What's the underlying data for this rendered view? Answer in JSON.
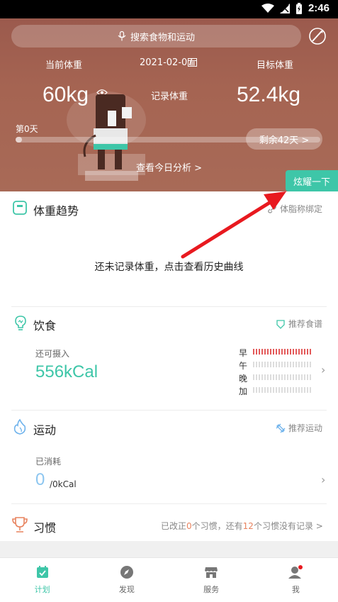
{
  "status_bar": {
    "time": "2:46"
  },
  "header": {
    "search_placeholder": "搜索食物和运动",
    "current_weight_label": "当前体重",
    "date": "2021-02-07",
    "target_weight_label": "目标体重",
    "current_weight": "60kg",
    "record_weight_label": "记录体重",
    "target_weight": "52.4kg",
    "day_label": "第0天",
    "remaining_label": "剩余42天 >",
    "progress": 0.02,
    "analysis_link": "查看今日分析 >"
  },
  "brag_button": "炫耀一下",
  "weight_trend": {
    "title": "体重趋势",
    "action": "体脂称绑定",
    "empty_text": "还未记录体重，点击查看历史曲线"
  },
  "diet": {
    "title": "饮食",
    "action": "推荐食谱",
    "remaining_label": "还可摄入",
    "kcal": "556kCal",
    "meals": [
      "早",
      "午",
      "晚",
      "加"
    ]
  },
  "exercise": {
    "title": "运动",
    "action": "推荐运动",
    "burned_label": "已消耗",
    "burned_value": "0",
    "burned_unit": "/0kCal"
  },
  "habit": {
    "title": "习惯",
    "text_a": "已改正",
    "num_a": "0",
    "text_b": "个习惯，还有",
    "num_b": "12",
    "text_c": "个习惯没有记录 >"
  },
  "nav": {
    "plan": "计划",
    "discover": "发现",
    "service": "服务",
    "me": "我"
  },
  "colors": {
    "accent": "#3ec6a8",
    "hero": "#a56452",
    "alert": "#e35a5a"
  }
}
